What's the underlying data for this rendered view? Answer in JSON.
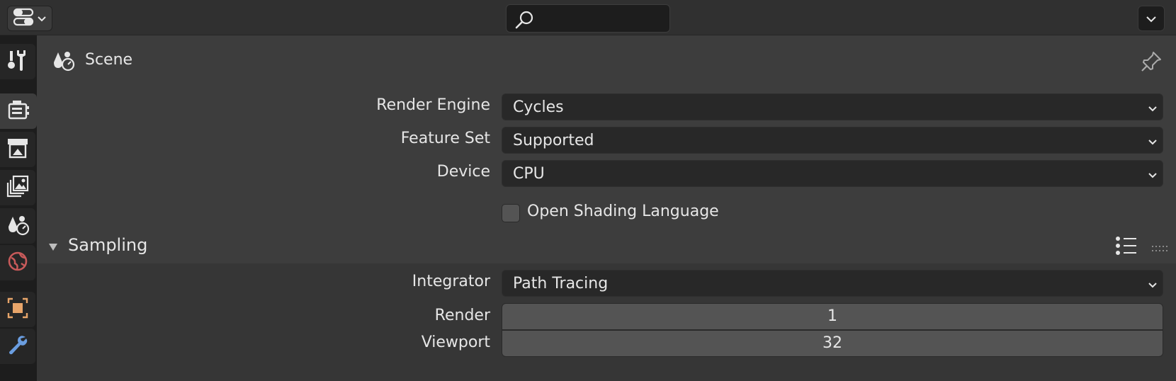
{
  "topbar": {
    "search": {
      "placeholder": "",
      "value": ""
    },
    "editor_type_icon": "properties-editor-icon",
    "options_icon": "chevron-down-icon"
  },
  "tabs": [
    {
      "name": "tool",
      "icon": "tool-settings-icon",
      "active": false
    },
    {
      "name": "render",
      "icon": "render-properties-icon",
      "active": true
    },
    {
      "name": "output",
      "icon": "output-properties-icon",
      "active": false
    },
    {
      "name": "view-layer",
      "icon": "view-layer-icon",
      "active": false
    },
    {
      "name": "scene",
      "icon": "scene-properties-icon",
      "active": false
    },
    {
      "name": "world",
      "icon": "world-properties-icon",
      "active": false
    },
    {
      "name": "object",
      "icon": "object-properties-icon",
      "active": false
    },
    {
      "name": "modifiers",
      "icon": "modifier-wrench-icon",
      "active": false
    }
  ],
  "header": {
    "title": "Scene"
  },
  "render": {
    "engine": {
      "label": "Render Engine",
      "value": "Cycles"
    },
    "feature_set": {
      "label": "Feature Set",
      "value": "Supported"
    },
    "device": {
      "label": "Device",
      "value": "CPU"
    },
    "osl": {
      "label": "Open Shading Language",
      "checked": false
    }
  },
  "sampling": {
    "title": "Sampling",
    "integrator": {
      "label": "Integrator",
      "value": "Path Tracing"
    },
    "render": {
      "label": "Render",
      "value": "1"
    },
    "viewport": {
      "label": "Viewport",
      "value": "32"
    }
  },
  "colors": {
    "accent_blue": "#4772b3",
    "world_red": "#c85a5a",
    "object_orange": "#e8a56a",
    "wrench_blue": "#6a9de0"
  }
}
